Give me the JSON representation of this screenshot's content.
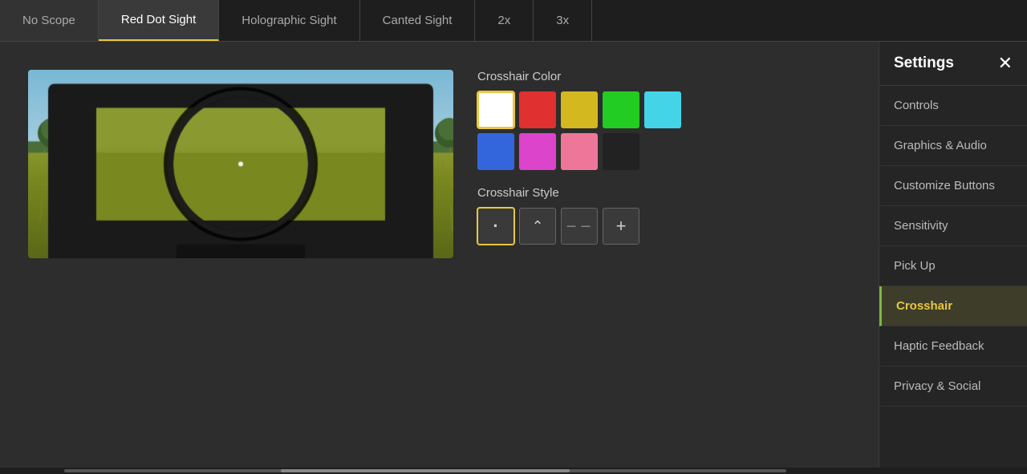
{
  "tabs": [
    {
      "id": "no-scope",
      "label": "No Scope",
      "active": false
    },
    {
      "id": "red-dot",
      "label": "Red Dot Sight",
      "active": true
    },
    {
      "id": "holographic",
      "label": "Holographic Sight",
      "active": false
    },
    {
      "id": "canted",
      "label": "Canted Sight",
      "active": false
    },
    {
      "id": "2x",
      "label": "2x",
      "active": false
    },
    {
      "id": "3x",
      "label": "3x",
      "active": false
    }
  ],
  "crosshair": {
    "color_label": "Crosshair Color",
    "style_label": "Crosshair Style",
    "colors": [
      {
        "id": "white",
        "hex": "#ffffff",
        "selected": true
      },
      {
        "id": "red",
        "hex": "#e03030",
        "selected": false
      },
      {
        "id": "yellow",
        "hex": "#d4b820",
        "selected": false
      },
      {
        "id": "green",
        "hex": "#22cc22",
        "selected": false
      },
      {
        "id": "cyan",
        "hex": "#44d4e8",
        "selected": false
      },
      {
        "id": "blue",
        "hex": "#3366dd",
        "selected": false
      },
      {
        "id": "magenta",
        "hex": "#dd44cc",
        "selected": false
      },
      {
        "id": "pink",
        "hex": "#ee7799",
        "selected": false
      },
      {
        "id": "black",
        "hex": "#222222",
        "selected": false
      }
    ],
    "styles": [
      {
        "id": "dot",
        "symbol": "·",
        "selected": true
      },
      {
        "id": "chevron",
        "symbol": "⌃",
        "selected": false
      },
      {
        "id": "dash",
        "symbol": "— —",
        "selected": false
      },
      {
        "id": "cross",
        "symbol": "+",
        "selected": false
      }
    ]
  },
  "sidebar": {
    "title": "Settings",
    "close_label": "✕",
    "items": [
      {
        "id": "controls",
        "label": "Controls",
        "active": false
      },
      {
        "id": "graphics-audio",
        "label": "Graphics & Audio",
        "active": false
      },
      {
        "id": "customize-buttons",
        "label": "Customize Buttons",
        "active": false
      },
      {
        "id": "sensitivity",
        "label": "Sensitivity",
        "active": false
      },
      {
        "id": "pick-up",
        "label": "Pick Up",
        "active": false
      },
      {
        "id": "crosshair",
        "label": "Crosshair",
        "active": true
      },
      {
        "id": "haptic-feedback",
        "label": "Haptic Feedback",
        "active": false
      },
      {
        "id": "privacy-social",
        "label": "Privacy & Social",
        "active": false
      }
    ]
  }
}
